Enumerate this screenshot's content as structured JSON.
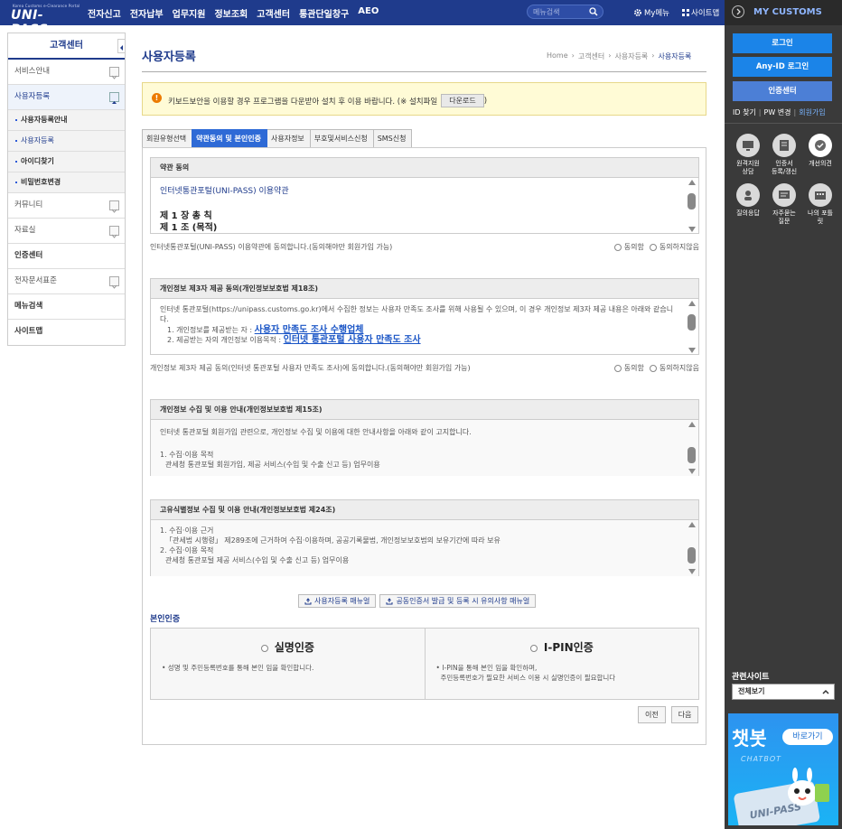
{
  "header": {
    "logo_small": "Korea Customs e-Clearance Portal",
    "logo_main": "UNI-PASS",
    "menu": [
      "전자신고",
      "전자납부",
      "업무지원",
      "정보조회",
      "고객센터",
      "통관단일창구",
      "AEO"
    ],
    "search_placeholder": "메뉴검색",
    "my_menu": "My메뉴",
    "sitemap": "사이트맵"
  },
  "my_customs": {
    "title": "MY CUSTOMS",
    "login": "로그인",
    "anyid_login": "Any-ID 로그인",
    "cert_center": "인증센터",
    "links": [
      "ID 찾기",
      "PW 변경",
      "회원가입"
    ],
    "icons": [
      {
        "label": "원격지원\n상담",
        "icon": "remote-support-icon"
      },
      {
        "label": "인증서\n등록/갱신",
        "icon": "certificate-icon"
      },
      {
        "label": "개선의견",
        "icon": "feedback-icon"
      },
      {
        "label": "질의응답",
        "icon": "qa-icon"
      },
      {
        "label": "자주묻는\n질문",
        "icon": "faq-icon"
      },
      {
        "label": "나의 포틀\n릿",
        "icon": "portlet-icon"
      }
    ],
    "related_title": "관련사이트",
    "related_select": "전체보기",
    "chatbot_title": "챗봇",
    "chatbot_sub": "CHATBOT",
    "chatbot_go": "바로가기",
    "chatbot_caption": "UNI-PASS"
  },
  "lnb": {
    "title": "고객센터",
    "items": [
      {
        "label": "서비스안내",
        "type": "item",
        "expand": true
      },
      {
        "label": "사용자등록",
        "type": "item",
        "expand": true,
        "open": true
      },
      {
        "label": "사용자등록안내",
        "type": "sub"
      },
      {
        "label": "사용자등록",
        "type": "sub",
        "current": true
      },
      {
        "label": "아이디찾기",
        "type": "sub"
      },
      {
        "label": "비밀번호변경",
        "type": "sub"
      },
      {
        "label": "커뮤니티",
        "type": "item",
        "expand": true
      },
      {
        "label": "자료실",
        "type": "item",
        "expand": true
      },
      {
        "label": "인증센터",
        "type": "item",
        "bold": true
      },
      {
        "label": "전자문서표준",
        "type": "item",
        "expand": true
      },
      {
        "label": "메뉴검색",
        "type": "item",
        "bold": true
      },
      {
        "label": "사이트맵",
        "type": "item",
        "bold": true
      }
    ]
  },
  "page": {
    "title": "사용자등록",
    "breadcrumb": [
      "Home",
      "고객센터",
      "사용자등록",
      "사용자등록"
    ],
    "notice": "키보드보안을 이용할 경우 프로그램을 다운받아 설치 후 이용 바랍니다. (※ 설치파일",
    "notice_btn": "다운로드",
    "notice_end": ")",
    "steps": [
      "회원유형선택",
      "약관동의 및 본인인증",
      "사용자정보",
      "부호및서비스신청",
      "SMS신청"
    ]
  },
  "sections": {
    "terms": {
      "head": "약관 동의",
      "title": "인터넷통관포털(UNI-PASS) 이용약관",
      "chapter": "제 1 장 총 칙",
      "article": "제 1 조 (목적)",
      "agree_text": "인터넷통관포털(UNI-PASS) 이용약관에 동의합니다.(동의해야만 회원가입 가능)",
      "agree": "동의함",
      "disagree": "동의하지않음"
    },
    "third_party": {
      "head": "개인정보 제3자 제공 동의(개인정보보호법 제18조)",
      "body1": "인터넷 통관포털(https://unipass.customs.go.kr)에서 수집한 정보는 사용자 만족도 조사를 위해 사용될 수 있으며, 이 경우 개인정보 제3자 제공 내용은 아래와 같습니다.",
      "item1_label": "1. 개인정보를 제공받는 자 :",
      "item1_value": "사용자 만족도 조사 수행업체",
      "item2_label": "2. 제공받는 자의 개인정보 이용목적 :",
      "item2_value": "인터넷 통관포털 사용자 만족도 조사",
      "agree_text": "개인정보 제3자 제공 동의(인터넷 통관포털 사용자 만족도 조사)에 동의합니다.(동의해야만 회원가입 가능)",
      "agree": "동의함",
      "disagree": "동의하지않음"
    },
    "collect": {
      "head": "개인정보 수집 및 이용 안내(개인정보보호법 제15조)",
      "body1": "인터넷 통관포털 회원가입 관련으로, 개인정보 수집 및 이용에 대한 안내사항을 아래와 같이 고지합니다.",
      "body2": "1. 수집·이용 목적",
      "body3": "관세청 통관포털 회원가입, 제공 서비스(수입 및 수출 신고 등) 업무이용"
    },
    "unique": {
      "head": "고유식별정보 수집 및 이용 안내(개인정보보호법 제24조)",
      "body1": "1. 수집·이용 근거",
      "body2": "「관세법 시행령」 제289조에 근거하여 수집·이용하며, 공공기록물법, 개인정보보호법의 보유기간에 따라 보유",
      "body3": "2. 수집·이용 목적",
      "body4": "관세청 통관포털 제공 서비스(수입 및 수출 신고 등) 업무이용"
    }
  },
  "manuals": [
    "사용자등록 매뉴얼",
    "공동인증서 발급 및 등록 시 유의사항 매뉴얼"
  ],
  "verify": {
    "title": "본인인증",
    "real_name": "실명인증",
    "real_name_desc": "• 성명 및 주민등록번호를 통해 본인 임을 확인합니다.",
    "ipin": "I-PIN인증",
    "ipin_desc1": "• I-PIN을 통해 본인 임을 확인하며,",
    "ipin_desc2": "주민등록번호가 필요한 서비스 이용 시 실명인증이 필요합니다"
  },
  "nav": {
    "prev": "이전",
    "next": "다음"
  }
}
